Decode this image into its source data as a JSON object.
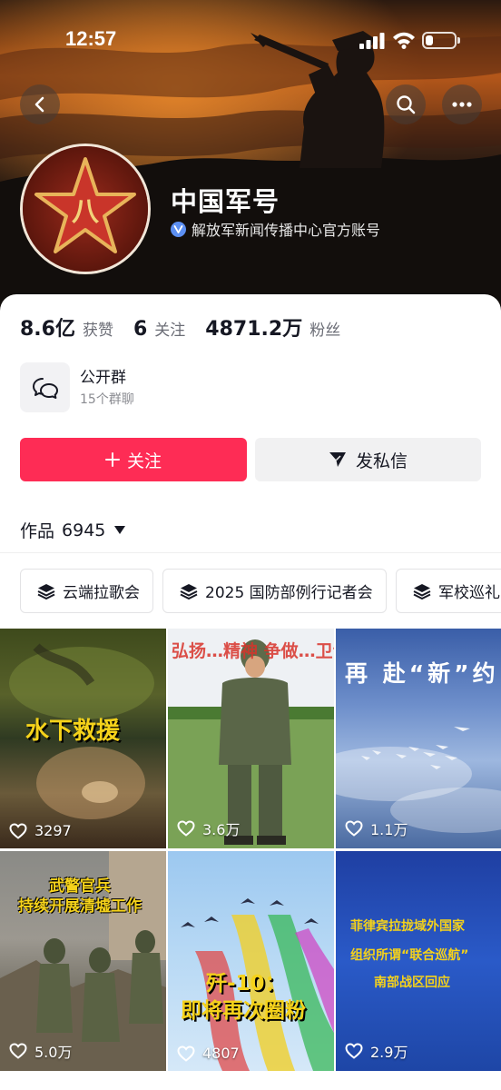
{
  "status": {
    "time": "12:57",
    "battery_level": 0.25
  },
  "profile": {
    "name": "中国军号",
    "verification": "解放军新闻传播中心官方账号",
    "avatar_text": "八"
  },
  "stats": [
    {
      "value": "8.6亿",
      "label": "获赞"
    },
    {
      "value": "6",
      "label": "关注"
    },
    {
      "value": "4871.2万",
      "label": "粉丝"
    }
  ],
  "group": {
    "title": "公开群",
    "subtitle": "15个群聊"
  },
  "actions": {
    "follow": "关注",
    "message": "发私信"
  },
  "works": {
    "label": "作品",
    "count": "6945"
  },
  "collections": [
    "云端拉歌会",
    "2025 国防部例行记者会",
    "军校巡礼"
  ],
  "videos": [
    {
      "likes": "3297",
      "caption": "水下救援"
    },
    {
      "likes": "3.6万",
      "caption": "弘扬…精神 争做…卫士"
    },
    {
      "likes": "1.1万",
      "caption": "再 赴“新”约"
    },
    {
      "likes": "5.0万",
      "caption_line1": "武警官兵",
      "caption_line2": "持续开展清墟工作"
    },
    {
      "likes": "4807",
      "caption_line1": "歼-10：",
      "caption_line2": "即将再次圈粉"
    },
    {
      "likes": "2.9万",
      "caption_line1": "菲律宾拉拢域外国家",
      "caption_line2": "组织所谓“联合巡航”",
      "caption_line3": "南部战区回应"
    }
  ],
  "colors": {
    "accent": "#fe2c55",
    "verify_badge": "#5c8ff2"
  },
  "icons": [
    "back-icon",
    "search-icon",
    "more-icon",
    "verified-icon",
    "chat-bubble-icon",
    "plus-icon",
    "send-icon",
    "stack-icon",
    "heart-icon"
  ]
}
